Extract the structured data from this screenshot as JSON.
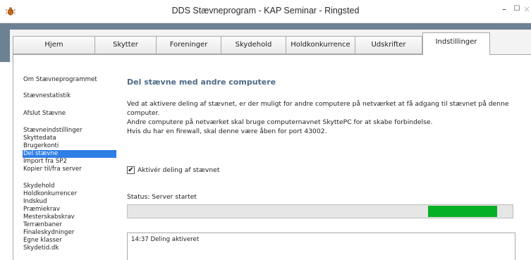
{
  "window": {
    "title": "DDS Stævneprogram - KAP Seminar - Ringsted",
    "app_icon": "bug-icon",
    "controls": {
      "minimize": "–",
      "maximize": "☐",
      "close": "×"
    }
  },
  "colors": {
    "band": "#6d8194",
    "selected_item": "#2f7ee6",
    "section_title": "#4e6a86",
    "progress_fill": "#06b025"
  },
  "tabs": [
    {
      "label": "Hjem",
      "active": false
    },
    {
      "label": "Skytter",
      "active": false
    },
    {
      "label": "Foreninger",
      "active": false
    },
    {
      "label": "Skydehold",
      "active": false
    },
    {
      "label": "Holdkonkurrence",
      "active": false
    },
    {
      "label": "Udskrifter",
      "active": false
    },
    {
      "label": "Indstillinger",
      "active": true
    }
  ],
  "sidebar": {
    "items": [
      {
        "label": "Om Stævneprogrammet",
        "selected": false
      },
      {
        "label": "Stævnestatistik",
        "selected": false
      },
      {
        "label": "Afslut Stævne",
        "selected": false
      },
      {
        "label": "Stævneindstillinger",
        "selected": false
      },
      {
        "label": "Skyttedata",
        "selected": false
      },
      {
        "label": "Brugerkonti",
        "selected": false
      },
      {
        "label": "Del stævne",
        "selected": true
      },
      {
        "label": "Import fra SP2",
        "selected": false
      },
      {
        "label": "Kopier til/fra server",
        "selected": false
      },
      {
        "label": "Skydehold",
        "selected": false
      },
      {
        "label": "Holdkonkurrencer",
        "selected": false
      },
      {
        "label": "Indskud",
        "selected": false
      },
      {
        "label": "Præmiekrav",
        "selected": false
      },
      {
        "label": "Mesterskabskrav",
        "selected": false
      },
      {
        "label": "Terrænbaner",
        "selected": false
      },
      {
        "label": "Finaleskydninger",
        "selected": false
      },
      {
        "label": "Egne klasser",
        "selected": false
      },
      {
        "label": "Skydetid.dk",
        "selected": false
      }
    ]
  },
  "main": {
    "title": "Del stævne med andre computere",
    "description": [
      "Ved at aktivere deling af stævnet, er der muligt for andre computere på netværket at få adgang til stævnet på denne",
      "computer.",
      "Andre computere på netværket skal bruge computernavnet SkyttePC for at skabe forbindelse.",
      "Hvis du har en firewall, skal denne være åben for port 43002."
    ],
    "checkbox": {
      "label": "Aktivér deling af stævnet",
      "checked": true,
      "mark": "✔"
    },
    "status": "Status: Server startet",
    "progress": {
      "fill_start": 0.78,
      "fill_end": 0.96
    },
    "log": [
      "14:37 Deling aktiveret"
    ]
  }
}
